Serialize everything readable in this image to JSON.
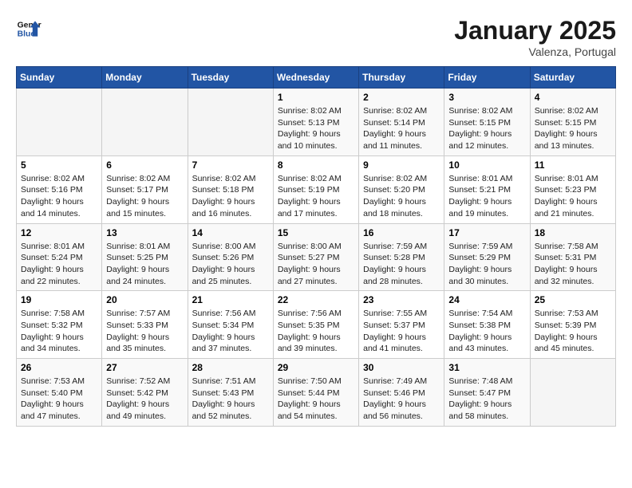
{
  "logo": {
    "line1": "General",
    "line2": "Blue"
  },
  "title": "January 2025",
  "subtitle": "Valenza, Portugal",
  "weekdays": [
    "Sunday",
    "Monday",
    "Tuesday",
    "Wednesday",
    "Thursday",
    "Friday",
    "Saturday"
  ],
  "weeks": [
    [
      null,
      null,
      null,
      {
        "day": "1",
        "sunrise": "8:02 AM",
        "sunset": "5:13 PM",
        "daylight": "9 hours and 10 minutes."
      },
      {
        "day": "2",
        "sunrise": "8:02 AM",
        "sunset": "5:14 PM",
        "daylight": "9 hours and 11 minutes."
      },
      {
        "day": "3",
        "sunrise": "8:02 AM",
        "sunset": "5:15 PM",
        "daylight": "9 hours and 12 minutes."
      },
      {
        "day": "4",
        "sunrise": "8:02 AM",
        "sunset": "5:15 PM",
        "daylight": "9 hours and 13 minutes."
      }
    ],
    [
      {
        "day": "5",
        "sunrise": "8:02 AM",
        "sunset": "5:16 PM",
        "daylight": "9 hours and 14 minutes."
      },
      {
        "day": "6",
        "sunrise": "8:02 AM",
        "sunset": "5:17 PM",
        "daylight": "9 hours and 15 minutes."
      },
      {
        "day": "7",
        "sunrise": "8:02 AM",
        "sunset": "5:18 PM",
        "daylight": "9 hours and 16 minutes."
      },
      {
        "day": "8",
        "sunrise": "8:02 AM",
        "sunset": "5:19 PM",
        "daylight": "9 hours and 17 minutes."
      },
      {
        "day": "9",
        "sunrise": "8:02 AM",
        "sunset": "5:20 PM",
        "daylight": "9 hours and 18 minutes."
      },
      {
        "day": "10",
        "sunrise": "8:01 AM",
        "sunset": "5:21 PM",
        "daylight": "9 hours and 19 minutes."
      },
      {
        "day": "11",
        "sunrise": "8:01 AM",
        "sunset": "5:23 PM",
        "daylight": "9 hours and 21 minutes."
      }
    ],
    [
      {
        "day": "12",
        "sunrise": "8:01 AM",
        "sunset": "5:24 PM",
        "daylight": "9 hours and 22 minutes."
      },
      {
        "day": "13",
        "sunrise": "8:01 AM",
        "sunset": "5:25 PM",
        "daylight": "9 hours and 24 minutes."
      },
      {
        "day": "14",
        "sunrise": "8:00 AM",
        "sunset": "5:26 PM",
        "daylight": "9 hours and 25 minutes."
      },
      {
        "day": "15",
        "sunrise": "8:00 AM",
        "sunset": "5:27 PM",
        "daylight": "9 hours and 27 minutes."
      },
      {
        "day": "16",
        "sunrise": "7:59 AM",
        "sunset": "5:28 PM",
        "daylight": "9 hours and 28 minutes."
      },
      {
        "day": "17",
        "sunrise": "7:59 AM",
        "sunset": "5:29 PM",
        "daylight": "9 hours and 30 minutes."
      },
      {
        "day": "18",
        "sunrise": "7:58 AM",
        "sunset": "5:31 PM",
        "daylight": "9 hours and 32 minutes."
      }
    ],
    [
      {
        "day": "19",
        "sunrise": "7:58 AM",
        "sunset": "5:32 PM",
        "daylight": "9 hours and 34 minutes."
      },
      {
        "day": "20",
        "sunrise": "7:57 AM",
        "sunset": "5:33 PM",
        "daylight": "9 hours and 35 minutes."
      },
      {
        "day": "21",
        "sunrise": "7:56 AM",
        "sunset": "5:34 PM",
        "daylight": "9 hours and 37 minutes."
      },
      {
        "day": "22",
        "sunrise": "7:56 AM",
        "sunset": "5:35 PM",
        "daylight": "9 hours and 39 minutes."
      },
      {
        "day": "23",
        "sunrise": "7:55 AM",
        "sunset": "5:37 PM",
        "daylight": "9 hours and 41 minutes."
      },
      {
        "day": "24",
        "sunrise": "7:54 AM",
        "sunset": "5:38 PM",
        "daylight": "9 hours and 43 minutes."
      },
      {
        "day": "25",
        "sunrise": "7:53 AM",
        "sunset": "5:39 PM",
        "daylight": "9 hours and 45 minutes."
      }
    ],
    [
      {
        "day": "26",
        "sunrise": "7:53 AM",
        "sunset": "5:40 PM",
        "daylight": "9 hours and 47 minutes."
      },
      {
        "day": "27",
        "sunrise": "7:52 AM",
        "sunset": "5:42 PM",
        "daylight": "9 hours and 49 minutes."
      },
      {
        "day": "28",
        "sunrise": "7:51 AM",
        "sunset": "5:43 PM",
        "daylight": "9 hours and 52 minutes."
      },
      {
        "day": "29",
        "sunrise": "7:50 AM",
        "sunset": "5:44 PM",
        "daylight": "9 hours and 54 minutes."
      },
      {
        "day": "30",
        "sunrise": "7:49 AM",
        "sunset": "5:46 PM",
        "daylight": "9 hours and 56 minutes."
      },
      {
        "day": "31",
        "sunrise": "7:48 AM",
        "sunset": "5:47 PM",
        "daylight": "9 hours and 58 minutes."
      },
      null
    ]
  ]
}
